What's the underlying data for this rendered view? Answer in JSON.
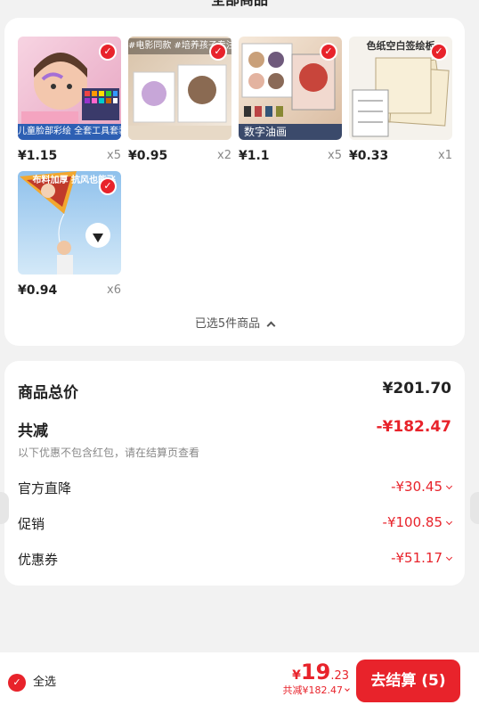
{
  "header": {
    "title": "全部商品"
  },
  "products": [
    {
      "price": "¥1.15",
      "qty": "x5",
      "caption": "儿童脸部彩绘  全套工具套装",
      "colors": [
        "#f6d2df",
        "#b56b8b"
      ]
    },
    {
      "price": "¥0.95",
      "qty": "x2",
      "caption": "#电影同款 #培养孩子专注力",
      "colors": [
        "#efe3d3",
        "#b08c6a"
      ]
    },
    {
      "price": "¥1.1",
      "qty": "x5",
      "caption": "数字油画",
      "colors": [
        "#f0ddc8",
        "#8a6a58"
      ]
    },
    {
      "price": "¥0.33",
      "qty": "x1",
      "caption": "色纸空白签绘板",
      "colors": [
        "#f4ecd5",
        "#c9b68e"
      ]
    },
    {
      "price": "¥0.94",
      "qty": "x6",
      "caption": "布料加厚 抗风也能飞",
      "colors": [
        "#9fc9ef",
        "#3b7fc2"
      ]
    }
  ],
  "selection": {
    "text": "已选5件商品"
  },
  "summary": {
    "goods_total_label": "商品总价",
    "goods_total_value": "¥201.70",
    "reduce_label": "共减",
    "reduce_value": "-¥182.47",
    "note": "以下优惠不包含红包，请在结算页查看",
    "official_label": "官方直降",
    "official_value": "-¥30.45",
    "promo_label": "促销",
    "promo_value": "-¥100.85",
    "coupon_label": "优惠券",
    "coupon_value": "-¥51.17"
  },
  "footer": {
    "select_all_label": "全选",
    "total_yen": "¥",
    "total_int": "19",
    "total_dec": ".23",
    "reduce_small": "共减¥182.47",
    "checkout_label": "去结算 (5)"
  },
  "accent_color": "#e8232b"
}
